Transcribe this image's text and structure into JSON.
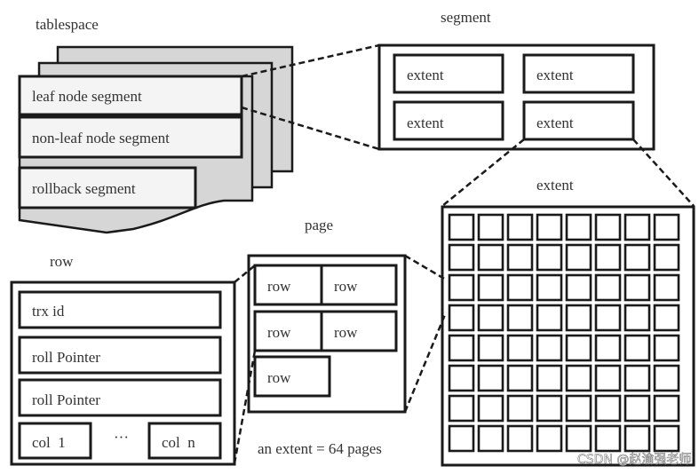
{
  "diagram": {
    "tablespace": {
      "title": "tablespace",
      "segments": [
        "leaf node segment",
        "non-leaf node segment",
        "rollback segment"
      ]
    },
    "segment": {
      "title": "segment",
      "extents": [
        "extent",
        "extent",
        "extent",
        "extent"
      ]
    },
    "extent": {
      "title": "extent",
      "grid_rows": 8,
      "grid_cols": 8
    },
    "page": {
      "title": "page",
      "rows": [
        "row",
        "row",
        "row",
        "row",
        "row"
      ],
      "caption": "an extent = 64 pages"
    },
    "row": {
      "title": "row",
      "fields": [
        "trx id",
        "roll Pointer",
        "roll Pointer"
      ],
      "col_first": "col  1",
      "ellipsis": "···",
      "col_last": "col  n"
    },
    "watermark": "CSDN @赵渝强老师"
  }
}
